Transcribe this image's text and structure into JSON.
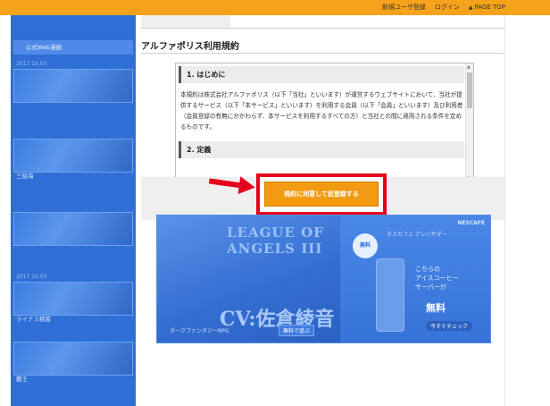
{
  "topnav": {
    "register": "新規ユーザ登録",
    "login": "ログイン",
    "page_top": "PAGE TOP",
    "page_top_icon": "caret-up-icon"
  },
  "colors": {
    "topbar": "#f6a21a",
    "accent_button": "#f39a13",
    "highlight_frame": "#e4001b",
    "overlay_blue": "#2f6fd6"
  },
  "sidebar": {
    "header": "公式Web漫画",
    "cards": [
      {
        "date": "2017.10.03",
        "title": "",
        "meta": ""
      },
      {
        "date": "",
        "title": "",
        "meta": ""
      },
      {
        "date": "",
        "title": "三船海",
        "meta": ""
      },
      {
        "date": "",
        "title": "",
        "meta": ""
      },
      {
        "date": "2017.10.03",
        "title": "ライナス精霊",
        "meta": ""
      },
      {
        "date": "",
        "title": "覇王",
        "meta": ""
      }
    ]
  },
  "main": {
    "terms_title": "アルファポリス利用規約",
    "sections": [
      {
        "heading": "1. はじめに",
        "body": "本規約は株式会社アルファポリス（以下「当社」といいます）が運営するウェブサイトにおいて、当社が提供するサービス（以下「本サービス」といいます）を利用する会員（以下「会員」といいます）及び利用者（会員登録の有無にかかわらず、本サービスを利用するすべての方）と当社との間に適用される条件を定めるものです。"
      },
      {
        "heading": "2. 定義",
        "body": ""
      }
    ],
    "agree_button": "規約に同意して仮登録する"
  },
  "ad": {
    "logo_text": "LEAGUE OF ANGELS III",
    "cv_text": "CV:佐倉綾音",
    "sub_text": "ダークファンタジーRPG",
    "free_badge": "無料で遊ぶ",
    "brand": "NESCAFE",
    "copy_a": "ネスカフェ アンバサダー",
    "copy_b": "こちらの\nアイスコーヒー\nサーバーが",
    "copy_c": "無料",
    "cta": "今すぐチェック",
    "circle": "無料"
  }
}
